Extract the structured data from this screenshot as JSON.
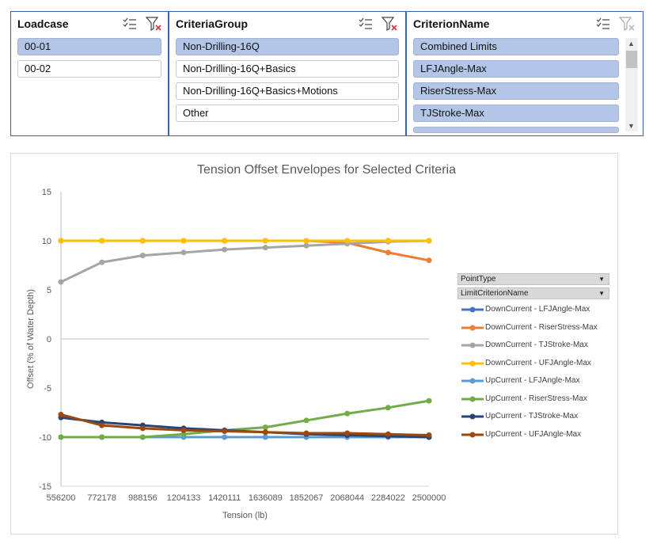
{
  "slicers": [
    {
      "title": "Loadcase",
      "items": [
        {
          "label": "00-01",
          "selected": true
        },
        {
          "label": "00-02",
          "selected": false
        }
      ],
      "filter_active": true
    },
    {
      "title": "CriteriaGroup",
      "items": [
        {
          "label": "Non-Drilling-16Q",
          "selected": true
        },
        {
          "label": "Non-Drilling-16Q+Basics",
          "selected": false
        },
        {
          "label": "Non-Drilling-16Q+Basics+Motions",
          "selected": false
        },
        {
          "label": "Other",
          "selected": false
        }
      ],
      "filter_active": true
    },
    {
      "title": "CriterionName",
      "items": [
        {
          "label": "Combined Limits",
          "selected": true
        },
        {
          "label": "LFJAngle-Max",
          "selected": true
        },
        {
          "label": "RiserStress-Max",
          "selected": true
        },
        {
          "label": "TJStroke-Max",
          "selected": true
        }
      ],
      "filter_active": false
    }
  ],
  "pivot_fields": {
    "point_type": "PointType",
    "limit_criterion_name": "LimitCriterionName"
  },
  "chart_data": {
    "type": "line",
    "title": "Tension Offset Envelopes for Selected Criteria",
    "xlabel": "Tension (lb)",
    "ylabel": "Offset (% of Water Depth)",
    "categories": [
      "556200",
      "772178",
      "988156",
      "1204133",
      "1420111",
      "1636089",
      "1852067",
      "2068044",
      "2284022",
      "2500000"
    ],
    "ylim": [
      -15,
      15
    ],
    "yticks": [
      15,
      10,
      5,
      0,
      -5,
      -10,
      -15
    ],
    "grid": false,
    "legend_position": "right",
    "series": [
      {
        "name": "DownCurrent - LFJAngle-Max",
        "color": "#4472c4",
        "values": [
          10,
          10,
          10,
          10,
          10,
          10,
          10,
          10,
          10,
          10
        ]
      },
      {
        "name": "DownCurrent - RiserStress-Max",
        "color": "#ed7d31",
        "values": [
          10,
          10,
          10,
          10,
          10,
          10,
          10,
          9.8,
          8.8,
          8.0
        ]
      },
      {
        "name": "DownCurrent - TJStroke-Max",
        "color": "#a5a5a5",
        "values": [
          5.8,
          7.8,
          8.5,
          8.8,
          9.1,
          9.3,
          9.5,
          9.7,
          9.9,
          10
        ]
      },
      {
        "name": "DownCurrent - UFJAngle-Max",
        "color": "#ffc000",
        "values": [
          10,
          10,
          10,
          10,
          10,
          10,
          10,
          10,
          10,
          10
        ]
      },
      {
        "name": "UpCurrent - LFJAngle-Max",
        "color": "#5b9bd5",
        "values": [
          -10,
          -10,
          -10,
          -10,
          -10,
          -10,
          -10,
          -10,
          -10,
          -10
        ]
      },
      {
        "name": "UpCurrent - RiserStress-Max",
        "color": "#70ad47",
        "values": [
          -10,
          -10,
          -10,
          -9.7,
          -9.3,
          -9.0,
          -8.3,
          -7.6,
          -7.0,
          -6.3
        ]
      },
      {
        "name": "UpCurrent - TJStroke-Max",
        "color": "#264478",
        "values": [
          -8.0,
          -8.5,
          -8.8,
          -9.1,
          -9.3,
          -9.5,
          -9.7,
          -9.8,
          -9.9,
          -10
        ]
      },
      {
        "name": "UpCurrent - UFJAngle-Max",
        "color": "#9e480e",
        "values": [
          -7.7,
          -8.8,
          -9.1,
          -9.3,
          -9.4,
          -9.5,
          -9.6,
          -9.6,
          -9.7,
          -9.8
        ]
      }
    ]
  }
}
